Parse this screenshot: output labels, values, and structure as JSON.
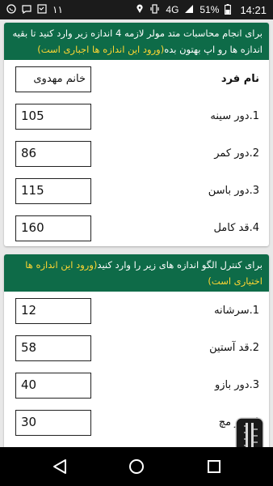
{
  "status_bar": {
    "time": "14:21",
    "battery_percent": "51%",
    "network": "4G",
    "left_icons": [
      "whatsapp-icon",
      "chat-icon",
      "gallery-icon",
      "notification-count-icon"
    ],
    "notification_count": "١١",
    "right_icons": [
      "location-icon",
      "vibrate-icon",
      "signal-icon",
      "battery-icon"
    ]
  },
  "card1": {
    "header_text": "برای انجام محاسبات متد مولر لازمه 4 اندازه زیر وارد کنید تا بقیه اندازه ها رو اپ بهتون بده",
    "header_highlight": "(ورود این اندازه ها اجباری است)",
    "fields": [
      {
        "label": "نام فرد",
        "value": "خانم مهدوی"
      },
      {
        "label": "1.دور سینه",
        "value": "105"
      },
      {
        "label": "2.دور کمر",
        "value": "86"
      },
      {
        "label": "3.دور باسن",
        "value": "115"
      },
      {
        "label": "4.قد کامل",
        "value": "160"
      }
    ]
  },
  "card2": {
    "header_text": "برای کنترل الگو اندازه های زیر را وارد کنید",
    "header_highlight": "(ورود این اندازه ها اختیاری است)",
    "fields": [
      {
        "label": "1.سرشانه",
        "value": "12"
      },
      {
        "label": "2.قد آستین",
        "value": "58"
      },
      {
        "label": "3.دور بازو",
        "value": "40"
      },
      {
        "label": "4.دور مچ",
        "value": "30"
      }
    ]
  },
  "colors": {
    "header_bg": "#0e6b48",
    "highlight": "#ffd632",
    "fab": "#1a1a1a"
  }
}
